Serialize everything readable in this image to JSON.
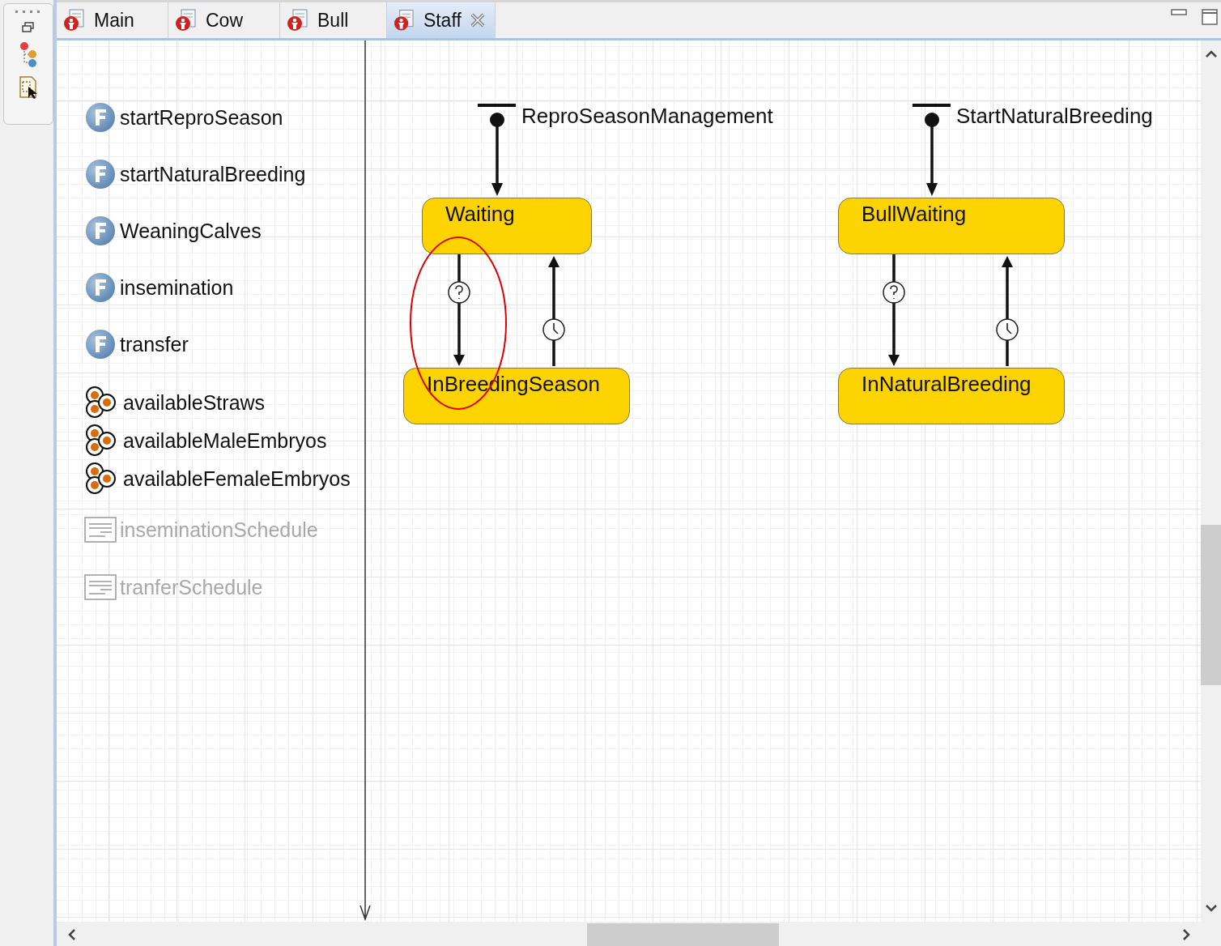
{
  "tabs": [
    {
      "label": "Main",
      "selected": false
    },
    {
      "label": "Cow",
      "selected": false
    },
    {
      "label": "Bull",
      "selected": false
    },
    {
      "label": "Staff",
      "selected": true
    }
  ],
  "elements": [
    {
      "kind": "function",
      "name": "startReproSeason"
    },
    {
      "kind": "function",
      "name": "startNaturalBreeding"
    },
    {
      "kind": "function",
      "name": "WeaningCalves"
    },
    {
      "kind": "function",
      "name": "insemination"
    },
    {
      "kind": "function",
      "name": "transfer"
    },
    {
      "kind": "collection",
      "name": "availableStraws"
    },
    {
      "kind": "collection",
      "name": "availableMaleEmbryos"
    },
    {
      "kind": "collection",
      "name": "availableFemaleEmbryos"
    },
    {
      "kind": "schedule",
      "name": "inseminationSchedule"
    },
    {
      "kind": "schedule",
      "name": "tranferSchedule"
    }
  ],
  "statecharts": [
    {
      "name": "ReproSeasonManagement",
      "states": [
        {
          "name": "Waiting"
        },
        {
          "name": "InBreedingSeason"
        }
      ],
      "transitions": [
        {
          "kind": "condition",
          "highlighted": true
        },
        {
          "kind": "timeout",
          "highlighted": false
        }
      ]
    },
    {
      "name": "StartNaturalBreeding",
      "states": [
        {
          "name": "BullWaiting"
        },
        {
          "name": "InNaturalBreeding"
        }
      ],
      "transitions": [
        {
          "kind": "condition",
          "highlighted": false
        },
        {
          "kind": "timeout",
          "highlighted": false
        }
      ]
    }
  ]
}
